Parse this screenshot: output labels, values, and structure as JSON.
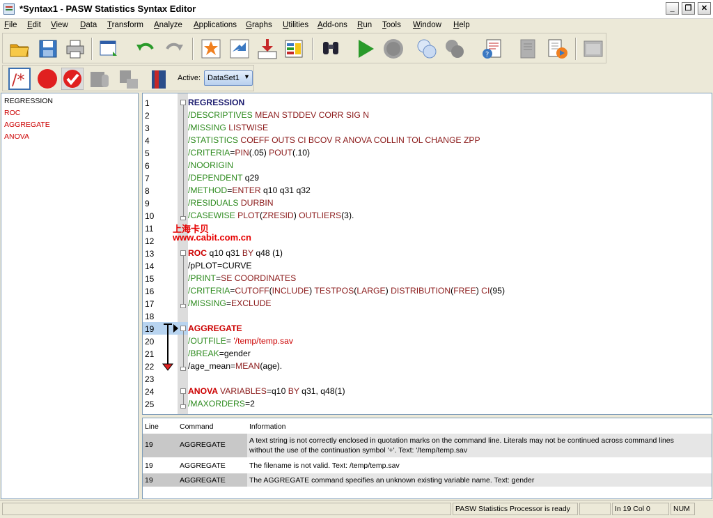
{
  "window": {
    "title": "*Syntax1 - PASW Statistics Syntax Editor",
    "controls": {
      "minimize": "_",
      "restore": "❐",
      "close": "✕"
    }
  },
  "menu": [
    {
      "label": "File",
      "u": "F",
      "rest": "ile"
    },
    {
      "label": "Edit",
      "u": "E",
      "rest": "dit"
    },
    {
      "label": "View",
      "u": "V",
      "rest": "iew"
    },
    {
      "label": "Data",
      "u": "D",
      "rest": "ata"
    },
    {
      "label": "Transform",
      "u": "T",
      "rest": "ransform"
    },
    {
      "label": "Analyze",
      "u": "A",
      "rest": "nalyze"
    },
    {
      "label": "Applications",
      "u": "A",
      "rest": "pplications"
    },
    {
      "label": "Graphs",
      "u": "G",
      "rest": "raphs"
    },
    {
      "label": "Utilities",
      "u": "U",
      "rest": "tilities"
    },
    {
      "label": "Add-ons",
      "u": "A",
      "rest": "dd-ons"
    },
    {
      "label": "Run",
      "u": "R",
      "rest": "un"
    },
    {
      "label": "Tools",
      "u": "T",
      "rest": "ools"
    },
    {
      "label": "Window",
      "u": "W",
      "rest": "indow"
    },
    {
      "label": "Help",
      "u": "H",
      "rest": "elp"
    }
  ],
  "toolbar2": {
    "active_label": "Active:",
    "dataset": "DataSet1"
  },
  "nav": [
    "REGRESSION",
    "ROC",
    "AGGREGATE",
    "ANOVA"
  ],
  "colors": {
    "keyword": "#1a1a6e",
    "subcommand": "#2e8b1f",
    "value": "#8b1a1a",
    "error": "#cc0000",
    "highlight": "#b8d4f0"
  },
  "code_lines": [
    {
      "n": "1",
      "parts": [
        [
          "kw",
          "REGRESSION"
        ]
      ]
    },
    {
      "n": "2",
      "parts": [
        [
          "g",
          "/DESCRIPTIVES "
        ],
        [
          "m",
          "MEAN STDDEV CORR SIG N"
        ]
      ]
    },
    {
      "n": "3",
      "parts": [
        [
          "g",
          "/MISSING "
        ],
        [
          "m",
          "LISTWISE"
        ]
      ]
    },
    {
      "n": "4",
      "parts": [
        [
          "g",
          "/STATISTICS "
        ],
        [
          "m",
          "COEFF OUTS CI BCOV R ANOVA COLLIN TOL CHANGE ZPP"
        ]
      ]
    },
    {
      "n": "5",
      "parts": [
        [
          "g",
          "/CRITERIA"
        ],
        [
          "bl",
          "="
        ],
        [
          "m",
          "PIN"
        ],
        [
          "bl",
          "(.05) "
        ],
        [
          "m",
          "POUT"
        ],
        [
          "bl",
          "(.10)"
        ]
      ]
    },
    {
      "n": "6",
      "parts": [
        [
          "g",
          "/NOORIGIN"
        ]
      ]
    },
    {
      "n": "7",
      "parts": [
        [
          "g",
          "/DEPENDENT "
        ],
        [
          "bl",
          "q29"
        ]
      ]
    },
    {
      "n": "8",
      "parts": [
        [
          "g",
          "/METHOD"
        ],
        [
          "bl",
          "="
        ],
        [
          "m",
          "ENTER "
        ],
        [
          "bl",
          "q10 q31 q32"
        ]
      ]
    },
    {
      "n": "9",
      "parts": [
        [
          "g",
          "/RESIDUALS "
        ],
        [
          "m",
          "DURBIN"
        ]
      ]
    },
    {
      "n": "10",
      "parts": [
        [
          "g",
          "/CASEWISE "
        ],
        [
          "m",
          "PLOT"
        ],
        [
          "bl",
          "("
        ],
        [
          "m",
          "ZRESID"
        ],
        [
          "bl",
          ") "
        ],
        [
          "m",
          "OUTLIERS"
        ],
        [
          "bl",
          "(3)."
        ]
      ]
    },
    {
      "n": "11",
      "parts": []
    },
    {
      "n": "12",
      "parts": []
    },
    {
      "n": "13",
      "parts": [
        [
          "red",
          "ROC "
        ],
        [
          "bl",
          "q10 q31 "
        ],
        [
          "m",
          "BY "
        ],
        [
          "bl",
          "q48 (1)"
        ]
      ]
    },
    {
      "n": "14",
      "parts": [
        [
          "bl",
          "/pPLOT=CURVE"
        ]
      ]
    },
    {
      "n": "15",
      "parts": [
        [
          "g",
          "/PRINT"
        ],
        [
          "bl",
          "="
        ],
        [
          "m",
          "SE COORDINATES"
        ]
      ]
    },
    {
      "n": "16",
      "parts": [
        [
          "g",
          "/CRITERIA"
        ],
        [
          "bl",
          "="
        ],
        [
          "m",
          "CUTOFF"
        ],
        [
          "bl",
          "("
        ],
        [
          "m",
          "INCLUDE"
        ],
        [
          "bl",
          ") "
        ],
        [
          "m",
          "TESTPOS"
        ],
        [
          "bl",
          "("
        ],
        [
          "m",
          "LARGE"
        ],
        [
          "bl",
          ") "
        ],
        [
          "m",
          "DISTRIBUTION"
        ],
        [
          "bl",
          "("
        ],
        [
          "m",
          "FREE"
        ],
        [
          "bl",
          ") "
        ],
        [
          "m",
          "CI"
        ],
        [
          "bl",
          "(95)"
        ]
      ]
    },
    {
      "n": "17",
      "parts": [
        [
          "g",
          "/MISSING"
        ],
        [
          "bl",
          "="
        ],
        [
          "m",
          "EXCLUDE"
        ]
      ]
    },
    {
      "n": "18",
      "parts": []
    },
    {
      "n": "19",
      "parts": [
        [
          "red",
          "AGGREGATE"
        ]
      ]
    },
    {
      "n": "20",
      "parts": [
        [
          "g",
          "/OUTFILE"
        ],
        [
          "bl",
          "= "
        ],
        [
          "red2",
          "'/temp/temp.sav"
        ]
      ]
    },
    {
      "n": "21",
      "parts": [
        [
          "g",
          "/BREAK"
        ],
        [
          "bl",
          "=gender"
        ]
      ]
    },
    {
      "n": "22",
      "parts": [
        [
          "bl",
          "/age_mean="
        ],
        [
          "m",
          "MEAN"
        ],
        [
          "bl",
          "(age)."
        ]
      ]
    },
    {
      "n": "23",
      "parts": []
    },
    {
      "n": "24",
      "parts": [
        [
          "red",
          "ANOVA "
        ],
        [
          "m",
          "VARIABLES"
        ],
        [
          "bl",
          "=q10 "
        ],
        [
          "m",
          "BY "
        ],
        [
          "bl",
          "q31, q48(1)"
        ]
      ]
    },
    {
      "n": "25",
      "parts": [
        [
          "g",
          "/MAXORDERS"
        ],
        [
          "bl",
          "=2"
        ]
      ]
    }
  ],
  "watermark": {
    "line1": "上海卡贝",
    "line2": "www.cabit.com.cn"
  },
  "errors": {
    "headers": [
      "Line",
      "Command",
      "Information"
    ],
    "rows": [
      {
        "line": "19",
        "command": "AGGREGATE",
        "info1": "A text string is not correctly enclosed in quotation marks on the command line.  Literals may not be continued across command lines",
        "info2": "without the use of the continuation symbol '+'.  Text: '/temp/temp.sav"
      },
      {
        "line": "19",
        "command": "AGGREGATE",
        "info1": "The filename is not valid.  Text: /temp/temp.sav",
        "info2": ""
      },
      {
        "line": "19",
        "command": "AGGREGATE",
        "info1": "The AGGREGATE command specifies an unknown existing variable name.  Text: gender",
        "info2": ""
      }
    ]
  },
  "status": {
    "processor": "PASW Statistics Processor is ready",
    "position": "In 19 Col 0",
    "num": "NUM"
  }
}
